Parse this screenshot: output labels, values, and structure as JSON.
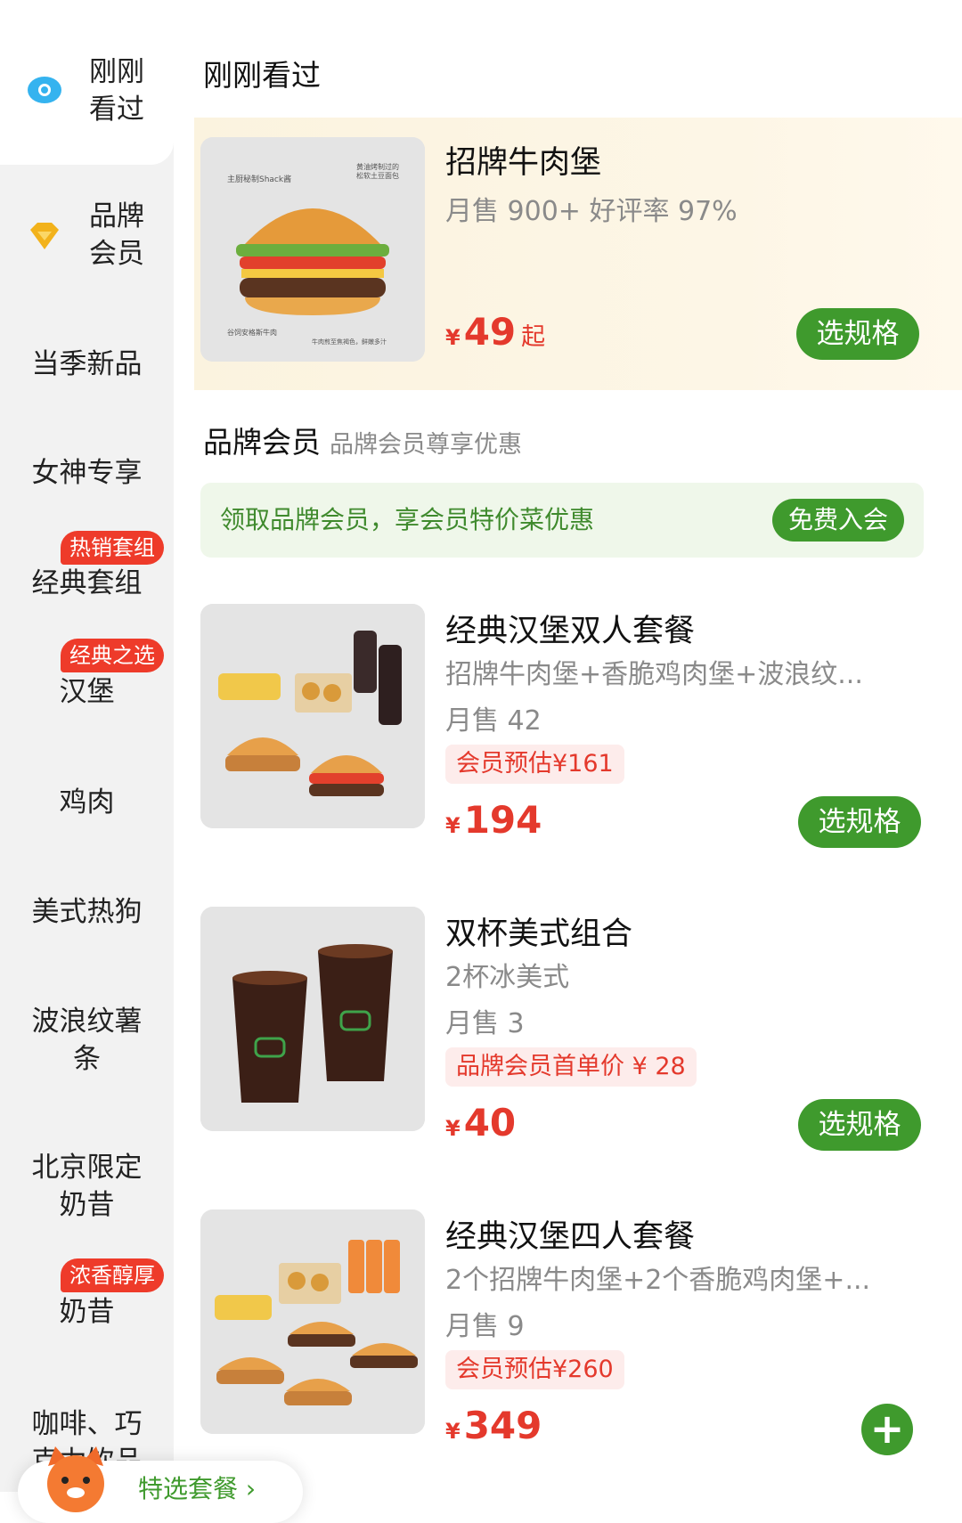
{
  "sidebar": {
    "items": [
      {
        "label_line1": "刚刚",
        "label_line2": "看过",
        "icon": "eye-icon"
      },
      {
        "label_line1": "品牌",
        "label_line2": "会员",
        "icon": "diamond-icon"
      },
      {
        "label": "当季新品"
      },
      {
        "label": "女神专享"
      },
      {
        "label": "经典套组",
        "badge": "热销套组"
      },
      {
        "label": "汉堡",
        "badge": "经典之选"
      },
      {
        "label": "鸡肉"
      },
      {
        "label": "美式热狗"
      },
      {
        "label_line1": "波浪纹薯",
        "label_line2": "条"
      },
      {
        "label_line1": "北京限定",
        "label_line2": "奶昔"
      },
      {
        "label": "奶昔",
        "badge": "浓香醇厚"
      },
      {
        "label_line1": "咖啡、巧",
        "label_line2": "克力饮品"
      }
    ]
  },
  "main": {
    "recent_title": "刚刚看过",
    "member_section": {
      "title": "品牌会员",
      "subtitle": "品牌会员尊享优惠"
    },
    "member_banner": {
      "text": "领取品牌会员，享会员特价菜优惠",
      "button": "免费入会"
    }
  },
  "products": [
    {
      "name": "招牌牛肉堡",
      "sales": "月售 900+ 好评率 97%",
      "currency": "¥",
      "price": "49",
      "price_suffix": "起",
      "button": "选规格"
    },
    {
      "name": "经典汉堡双人套餐",
      "desc": "招牌牛肉堡+香脆鸡肉堡+波浪纹...",
      "sales": "月售 42",
      "tag": "会员预估¥161",
      "currency": "¥",
      "price": "194",
      "button": "选规格"
    },
    {
      "name": "双杯美式组合",
      "desc": "2杯冰美式",
      "sales": "月售 3",
      "tag": "品牌会员首单价 ¥ 28",
      "currency": "¥",
      "price": "40",
      "button": "选规格"
    },
    {
      "name": "经典汉堡四人套餐",
      "desc": "2个招牌牛肉堡+2个香脆鸡肉堡+...",
      "sales": "月售 9",
      "tag": "会员预估¥260",
      "currency": "¥",
      "price": "349",
      "button": "+"
    }
  ],
  "image_labels": {
    "burger": [
      "主厨秘制Shack酱",
      "黄油烤制过的松软土豆面包",
      "谷饲安格斯牛肉",
      "牛肉煎至焦褐色，鲜嫩多汁"
    ]
  },
  "bottom_bar": {
    "text": "特选套餐 ›"
  },
  "colors": {
    "brand_green": "#3f9a2d",
    "price_red": "#e4392c",
    "highlight_bg": "#fbf3df",
    "sidebar_bg": "#f2f2f2"
  }
}
